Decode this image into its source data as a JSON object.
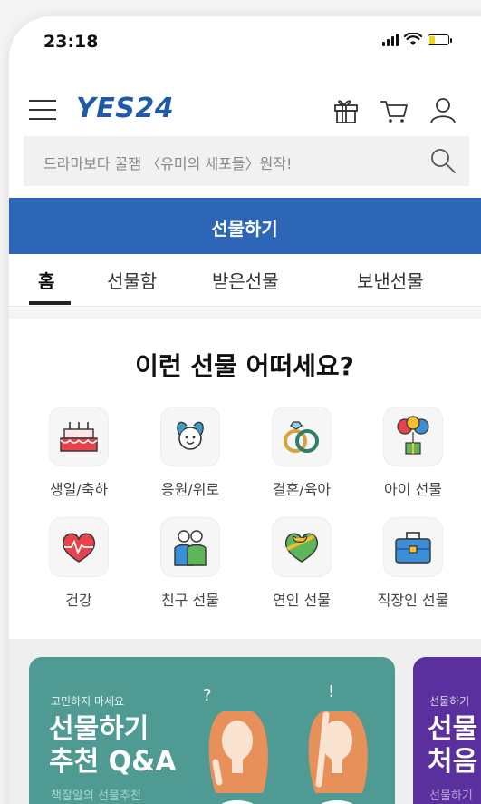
{
  "status_bar": {
    "time": "23:18",
    "battery_level": 0.3
  },
  "header": {
    "logo": "YES24",
    "icons": [
      "menu-icon",
      "gift-icon",
      "cart-icon",
      "user-icon"
    ]
  },
  "search": {
    "text": "드라마보다 꿀잼 〈유미의 세포들〉원작!"
  },
  "banner": {
    "title": "선물하기"
  },
  "tabs": [
    {
      "label": "홈",
      "active": true
    },
    {
      "label": "선물함",
      "active": false
    },
    {
      "label": "받은선물",
      "active": false
    },
    {
      "label": "보낸선물",
      "active": false
    }
  ],
  "recommend": {
    "title": "이런 선물 어떠세요?",
    "categories": [
      {
        "label": "생일/축하",
        "icon": "cake-icon"
      },
      {
        "label": "응원/위로",
        "icon": "cheer-icon"
      },
      {
        "label": "결혼/육아",
        "icon": "rings-icon"
      },
      {
        "label": "아이 선물",
        "icon": "balloons-icon"
      },
      {
        "label": "건강",
        "icon": "heart-icon"
      },
      {
        "label": "친구 선물",
        "icon": "friends-icon"
      },
      {
        "label": "연인 선물",
        "icon": "love-gift-icon"
      },
      {
        "label": "직장인 선물",
        "icon": "briefcase-icon"
      }
    ]
  },
  "cards": [
    {
      "small": "고민하지 마세요",
      "title_line1": "선물하기",
      "title_line2": "추천 Q&A",
      "sub": "책잘알의 선물추천",
      "color": "#4f9a93"
    },
    {
      "small": "선물하기",
      "title_line1": "선물",
      "title_line2": "처음",
      "sub": "선물하기",
      "color": "#5a2f9e"
    }
  ],
  "colors": {
    "brand": "#1f5aa8",
    "banner": "#2e66b7"
  }
}
